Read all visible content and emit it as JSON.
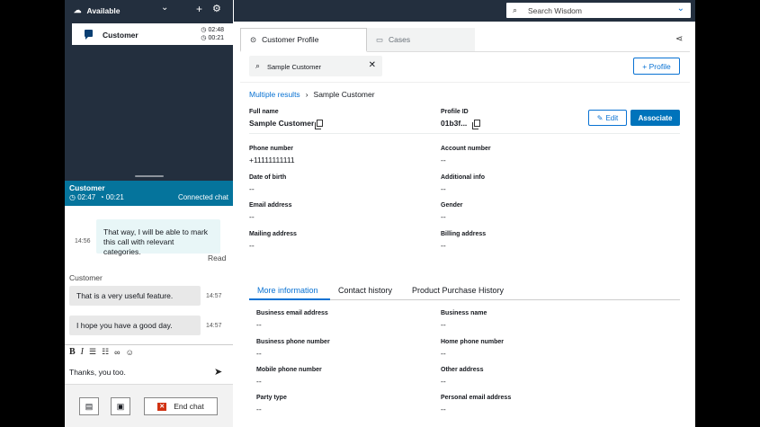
{
  "ccp": {
    "status": "Available",
    "contact_card": {
      "name": "Customer",
      "time1": "02:48",
      "time2": "00:21"
    },
    "connected_bar": {
      "name": "Customer",
      "timer1": "02:47",
      "timer2": "00:21",
      "state": "Connected chat"
    },
    "transcript": {
      "agent_message": "That way, I will be able to mark this call with relevant categories.",
      "agent_time": "14:56",
      "read_label": "Read",
      "customer_label": "Customer",
      "customer_messages": [
        {
          "text": "That is a very useful feature.",
          "time": "14:57"
        },
        {
          "text": "I hope you have a good day.",
          "time": "14:57"
        }
      ]
    },
    "composer": {
      "value": "Thanks, you too."
    },
    "end_chat_label": "End chat"
  },
  "wisdom": {
    "search_placeholder": "Search Wisdom",
    "tabs": [
      "Customer Profile",
      "Cases"
    ],
    "profile_search_value": "Sample Customer",
    "add_profile_label": "+ Profile",
    "breadcrumb": {
      "link": "Multiple results",
      "current": "Sample Customer"
    },
    "edit_label": "Edit",
    "associate_label": "Associate",
    "header_fields": [
      {
        "label": "Full name",
        "value": "Sample Customer"
      },
      {
        "label": "Profile ID",
        "value": "01b3f..."
      }
    ],
    "fields": [
      {
        "label": "Phone number",
        "value": "+11111111111"
      },
      {
        "label": "Account number",
        "value": "--"
      },
      {
        "label": "Date of birth",
        "value": "--"
      },
      {
        "label": "Additional info",
        "value": "--"
      },
      {
        "label": "Email address",
        "value": "--"
      },
      {
        "label": "Gender",
        "value": "--"
      },
      {
        "label": "Mailing address",
        "value": "--"
      },
      {
        "label": "Billing address",
        "value": "--"
      }
    ],
    "info_tabs": [
      "More information",
      "Contact history",
      "Product Purchase History"
    ],
    "more_info_fields": [
      {
        "label": "Business email address",
        "value": "--"
      },
      {
        "label": "Business name",
        "value": "--"
      },
      {
        "label": "Business phone number",
        "value": "--"
      },
      {
        "label": "Home phone number",
        "value": "--"
      },
      {
        "label": "Mobile phone number",
        "value": "--"
      },
      {
        "label": "Other address",
        "value": "--"
      },
      {
        "label": "Party type",
        "value": "--"
      },
      {
        "label": "Personal email address",
        "value": "--"
      }
    ]
  }
}
